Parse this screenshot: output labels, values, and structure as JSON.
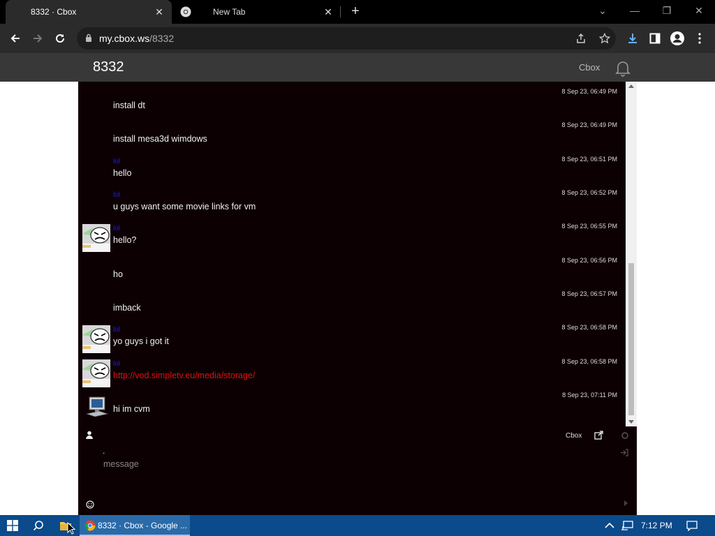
{
  "browser": {
    "tabs": [
      {
        "title": "8332 · Cbox",
        "active": true
      },
      {
        "title": "New Tab",
        "active": false
      }
    ],
    "url_host": "my.cbox.ws",
    "url_path": "/8332"
  },
  "site": {
    "title": "8332",
    "brand": "Cbox"
  },
  "messages": [
    {
      "user": "",
      "text": "install dt",
      "time": "8 Sep 23, 06:49 PM",
      "avatar": "none",
      "is_link": false
    },
    {
      "user": "",
      "text": "install mesa3d wimdows",
      "time": "8 Sep 23, 06:49 PM",
      "avatar": "none",
      "is_link": false
    },
    {
      "user": "lol",
      "text": "hello",
      "time": "8 Sep 23, 06:51 PM",
      "avatar": "none",
      "is_link": false
    },
    {
      "user": "lol",
      "text": "u guys want some movie links for vm",
      "time": "8 Sep 23, 06:52 PM",
      "avatar": "none",
      "is_link": false
    },
    {
      "user": "lol",
      "text": "hello?",
      "time": "8 Sep 23, 06:55 PM",
      "avatar": "troll",
      "is_link": false
    },
    {
      "user": "",
      "text": "ho",
      "time": "8 Sep 23, 06:56 PM",
      "avatar": "none",
      "is_link": false
    },
    {
      "user": "",
      "text": "imback",
      "time": "8 Sep 23, 06:57 PM",
      "avatar": "none",
      "is_link": false
    },
    {
      "user": "lol",
      "text": "yo guys i got it",
      "time": "8 Sep 23, 06:58 PM",
      "avatar": "troll",
      "is_link": false
    },
    {
      "user": "lol",
      "text": "http://vod.simpletv.eu/media/storage/",
      "time": "8 Sep 23, 06:58 PM",
      "avatar": "troll",
      "is_link": true
    },
    {
      "user": "",
      "text": "hi im cvm",
      "time": "8 Sep 23, 07:11 PM",
      "avatar": "computer",
      "is_link": false
    }
  ],
  "footer": {
    "cbox_label": "Cbox",
    "name_value": ".",
    "message_placeholder": "message"
  },
  "taskbar": {
    "chrome_label": "8332 · Cbox - Google ...",
    "clock": "7:12 PM"
  },
  "colors": {
    "chat_bg": "#0d0003",
    "username": "#1a1aff",
    "link": "#e01010",
    "taskbar": "#0b4a8b"
  }
}
